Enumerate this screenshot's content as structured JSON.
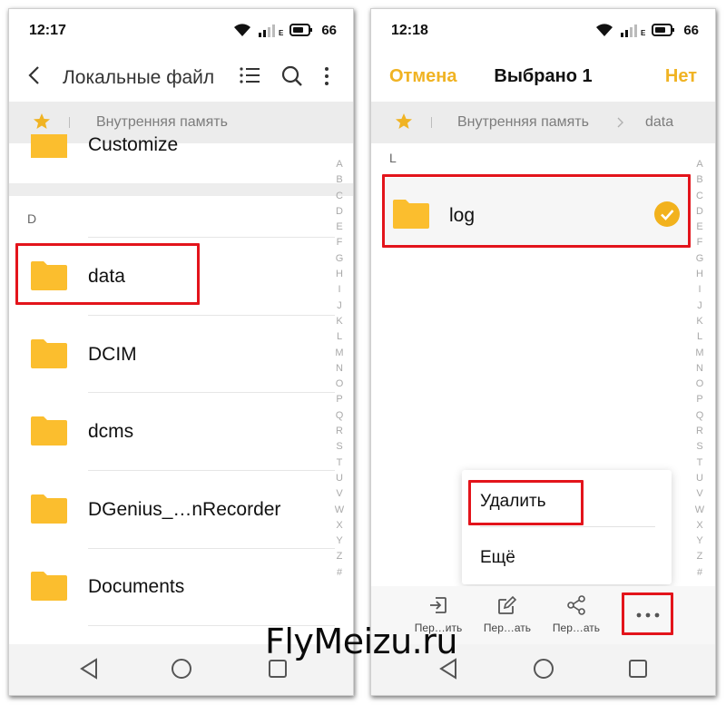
{
  "left_screen": {
    "status_bar": {
      "time": "12:17",
      "battery": "66",
      "network_label": "E"
    },
    "title_bar": {
      "title": "Локальные файл"
    },
    "breadcrumb": {
      "path": "Внутренняя память"
    },
    "partial_row": {
      "label": "Customize"
    },
    "section_letter": "D",
    "folders": [
      {
        "label": "data"
      },
      {
        "label": "DCIM"
      },
      {
        "label": "dcms"
      },
      {
        "label": "DGenius_…nRecorder"
      },
      {
        "label": "Documents"
      }
    ],
    "alphabet": [
      "A",
      "B",
      "C",
      "D",
      "E",
      "F",
      "G",
      "H",
      "I",
      "J",
      "K",
      "L",
      "M",
      "N",
      "O",
      "P",
      "Q",
      "R",
      "S",
      "T",
      "U",
      "V",
      "W",
      "X",
      "Y",
      "Z",
      "#"
    ]
  },
  "right_screen": {
    "status_bar": {
      "time": "12:18",
      "battery": "66",
      "network_label": "E"
    },
    "selection_header": {
      "cancel_label": "Отмена",
      "title": "Выбрано 1",
      "deselect_label": "Нет"
    },
    "breadcrumb": {
      "root": "Внутренняя память",
      "current": "data"
    },
    "section_letter": "L",
    "selected_folder": {
      "label": "log",
      "checked": true
    },
    "popup_menu": {
      "items": [
        {
          "label": "Удалить"
        },
        {
          "label": "Ещё"
        }
      ]
    },
    "action_bar": {
      "items": [
        {
          "label": "Пер…ить",
          "icon": "move-icon"
        },
        {
          "label": "Пер…ать",
          "icon": "rename-icon"
        },
        {
          "label": "Пер…ать",
          "icon": "share-icon"
        },
        {
          "label": "",
          "icon": "more-dots-icon"
        }
      ]
    },
    "alphabet": [
      "A",
      "B",
      "C",
      "D",
      "E",
      "F",
      "G",
      "H",
      "I",
      "J",
      "K",
      "L",
      "M",
      "N",
      "O",
      "P",
      "Q",
      "R",
      "S",
      "T",
      "U",
      "V",
      "W",
      "X",
      "Y",
      "Z",
      "#"
    ]
  },
  "colors": {
    "accent": "#f0b323",
    "folder": "#fbbe2e",
    "highlight": "#e3141b",
    "breadcrumb_bg": "#ececec"
  },
  "watermark": "FlyMeizu.ru"
}
